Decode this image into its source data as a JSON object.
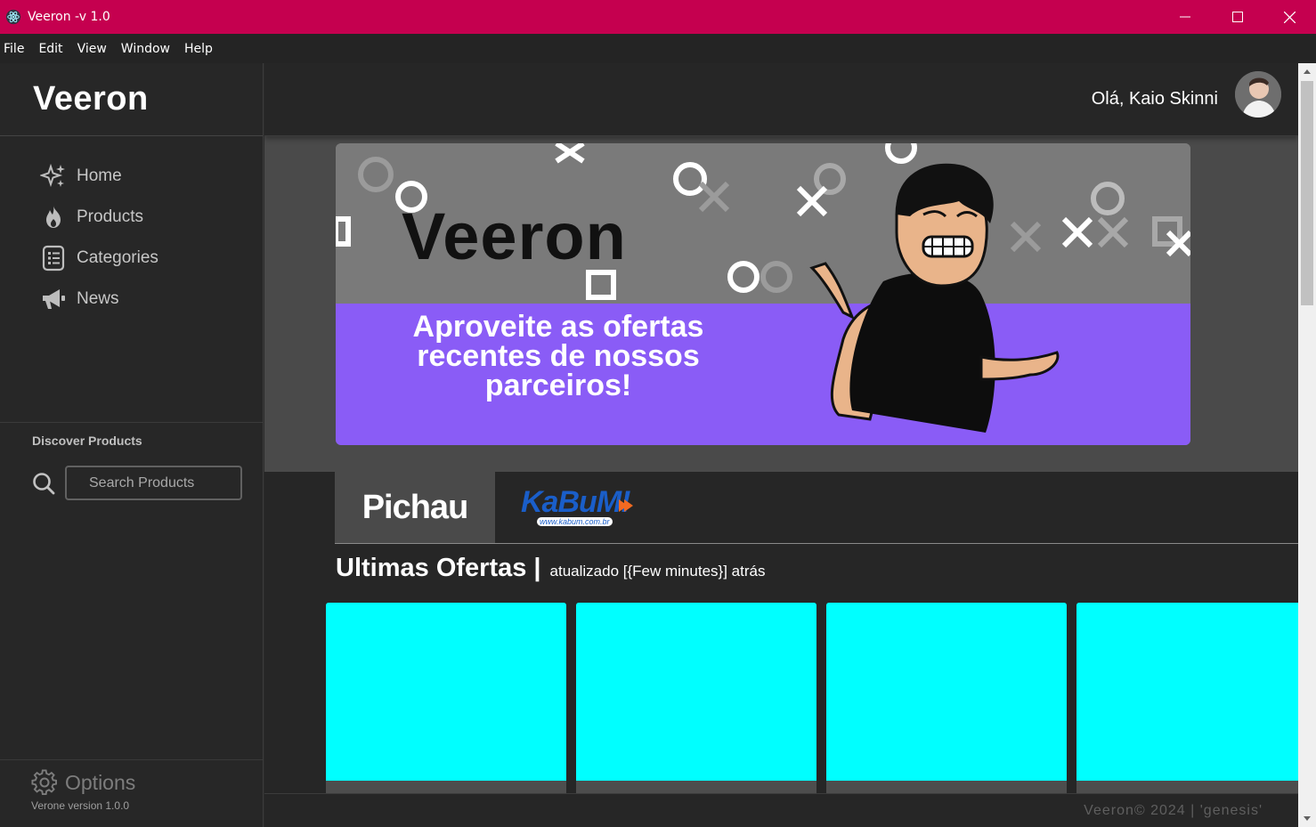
{
  "window": {
    "title": "Veeron -v 1.0",
    "accent": "#c5004f"
  },
  "menu": [
    "File",
    "Edit",
    "View",
    "Window",
    "Help"
  ],
  "sidebar": {
    "brand": "Veeron",
    "items": [
      {
        "label": "Home",
        "icon": "sparkles-icon"
      },
      {
        "label": "Products",
        "icon": "fire-icon"
      },
      {
        "label": "Categories",
        "icon": "list-icon"
      },
      {
        "label": "News",
        "icon": "megaphone-icon"
      }
    ],
    "discover_title": "Discover Products",
    "search_placeholder": "Search Products",
    "options_label": "Options",
    "version": "Verone version 1.0.0"
  },
  "header": {
    "greeting": "Olá, Kaio Skinni"
  },
  "banner": {
    "logo_text": "Veeron",
    "tagline": "Aproveite as ofertas recentes de nossos parceiros!",
    "purple": "#8a5cf6"
  },
  "tabs": [
    {
      "label": "Pichau",
      "active": true
    },
    {
      "label": "KaBuM!",
      "sub": "www.kabum.com.br",
      "active": false
    }
  ],
  "offers": {
    "title": "Ultimas Ofertas |",
    "updated": "atualizado [{Few minutes}] atrás",
    "card_color": "#00ffff",
    "card_count": 4
  },
  "footer": {
    "text": "Veeron© 2024 | 'genesis'"
  }
}
